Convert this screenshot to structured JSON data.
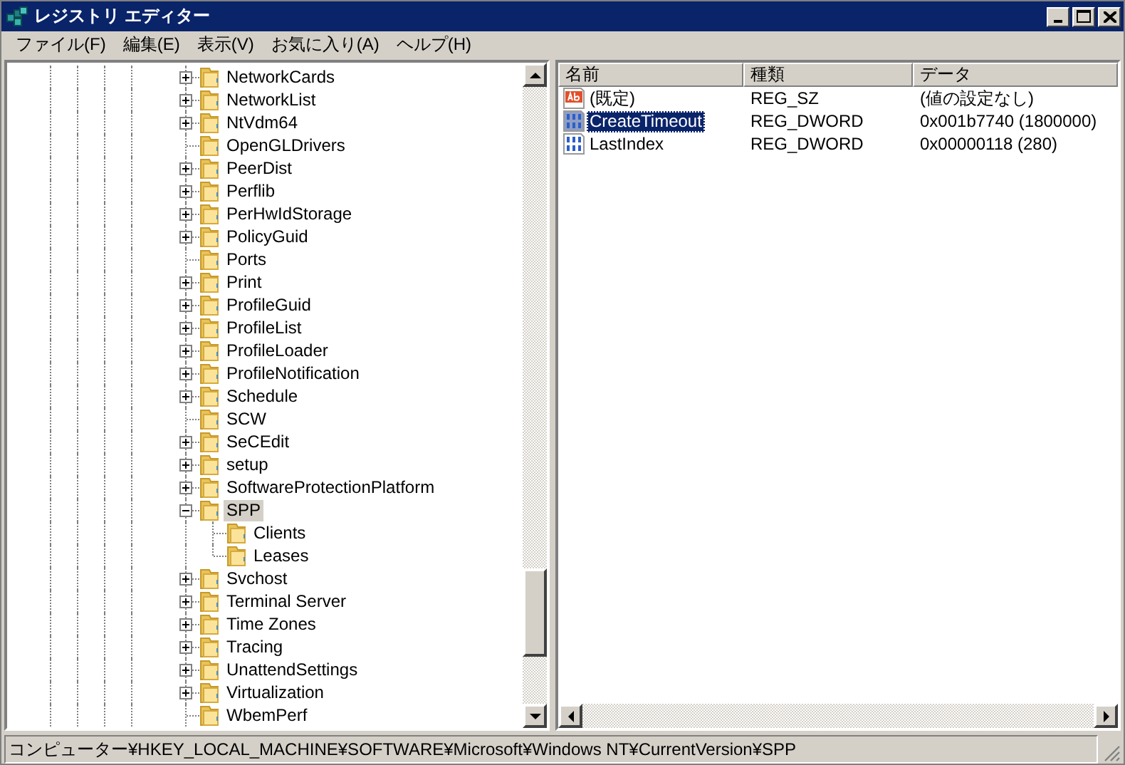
{
  "window": {
    "title": "レジストリ エディター"
  },
  "menu": [
    "ファイル(F)",
    "編集(E)",
    "表示(V)",
    "お気に入り(A)",
    "ヘルプ(H)"
  ],
  "tree": [
    {
      "label": "NetworkCards",
      "kind": "plus",
      "selected": false
    },
    {
      "label": "NetworkList",
      "kind": "plus",
      "selected": false
    },
    {
      "label": "NtVdm64",
      "kind": "plus",
      "selected": false
    },
    {
      "label": "OpenGLDrivers",
      "kind": "leaf",
      "selected": false
    },
    {
      "label": "PeerDist",
      "kind": "plus",
      "selected": false
    },
    {
      "label": "Perflib",
      "kind": "plus",
      "selected": false
    },
    {
      "label": "PerHwIdStorage",
      "kind": "plus",
      "selected": false
    },
    {
      "label": "PolicyGuid",
      "kind": "plus",
      "selected": false
    },
    {
      "label": "Ports",
      "kind": "leaf",
      "selected": false
    },
    {
      "label": "Print",
      "kind": "plus",
      "selected": false
    },
    {
      "label": "ProfileGuid",
      "kind": "plus",
      "selected": false
    },
    {
      "label": "ProfileList",
      "kind": "plus",
      "selected": false
    },
    {
      "label": "ProfileLoader",
      "kind": "plus",
      "selected": false
    },
    {
      "label": "ProfileNotification",
      "kind": "plus",
      "selected": false
    },
    {
      "label": "Schedule",
      "kind": "plus",
      "selected": false
    },
    {
      "label": "SCW",
      "kind": "leaf",
      "selected": false
    },
    {
      "label": "SeCEdit",
      "kind": "plus",
      "selected": false
    },
    {
      "label": "setup",
      "kind": "plus",
      "selected": false
    },
    {
      "label": "SoftwareProtectionPlatform",
      "kind": "plus",
      "selected": false
    },
    {
      "label": "SPP",
      "kind": "minus",
      "selected": true,
      "children": [
        {
          "label": "Clients",
          "selected": false
        },
        {
          "label": "Leases",
          "selected": false
        }
      ]
    },
    {
      "label": "Svchost",
      "kind": "plus",
      "selected": false
    },
    {
      "label": "Terminal Server",
      "kind": "plus",
      "selected": false
    },
    {
      "label": "Time Zones",
      "kind": "plus",
      "selected": false
    },
    {
      "label": "Tracing",
      "kind": "plus",
      "selected": false
    },
    {
      "label": "UnattendSettings",
      "kind": "plus",
      "selected": false
    },
    {
      "label": "Virtualization",
      "kind": "plus",
      "selected": false
    },
    {
      "label": "WbemPerf",
      "kind": "leaf",
      "selected": false
    }
  ],
  "values": {
    "columns": [
      "名前",
      "種類",
      "データ"
    ],
    "rows": [
      {
        "kind": "string",
        "name": "(既定)",
        "type": "REG_SZ",
        "data": "(値の設定なし)",
        "selected": false
      },
      {
        "kind": "dword",
        "name": "CreateTimeout",
        "type": "REG_DWORD",
        "data": "0x001b7740 (1800000)",
        "selected": true
      },
      {
        "kind": "dword",
        "name": "LastIndex",
        "type": "REG_DWORD",
        "data": "0x00000118 (280)",
        "selected": false
      }
    ]
  },
  "status_bar": "コンピューター¥HKEY_LOCAL_MACHINE¥SOFTWARE¥Microsoft¥Windows NT¥CurrentVersion¥SPP"
}
